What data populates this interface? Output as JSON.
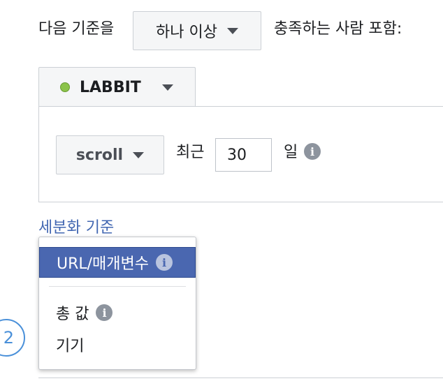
{
  "criteria": {
    "prefix": "다음 기준을",
    "match_select": "하나 이상",
    "suffix": "충족하는 사람 포함:"
  },
  "source": {
    "name": "LABBIT",
    "status_color": "#8bc34a"
  },
  "rule": {
    "event_select": "scroll",
    "recent_label": "최근",
    "days_value": "30",
    "days_unit": "일",
    "info_icon": "info-icon"
  },
  "refine_link": "세분화 기준",
  "dropdown": {
    "items": [
      {
        "label": "URL/매개변수",
        "selected": true
      },
      {
        "label": "총 값",
        "selected": false
      },
      {
        "label": "기기",
        "selected": false
      }
    ]
  },
  "step_number": "2"
}
